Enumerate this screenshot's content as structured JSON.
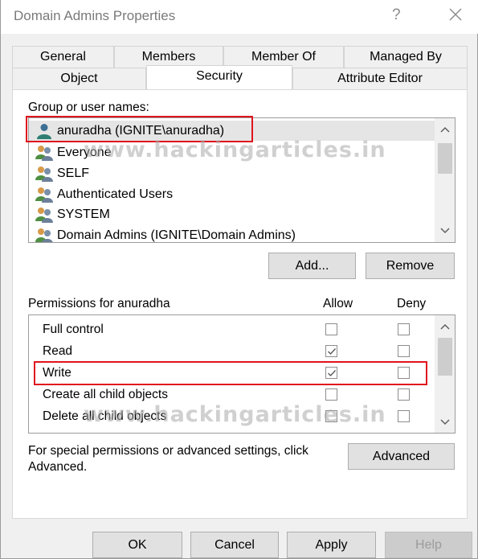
{
  "window": {
    "title": "Domain Admins Properties",
    "help_glyph": "?"
  },
  "tabs": {
    "general": "General",
    "members": "Members",
    "member_of": "Member Of",
    "managed_by": "Managed By",
    "object": "Object",
    "security": "Security",
    "attribute_editor": "Attribute Editor"
  },
  "group_users": {
    "label": "Group or user names:",
    "items": [
      "anuradha (IGNITE\\anuradha)",
      "Everyone",
      "SELF",
      "Authenticated Users",
      "SYSTEM",
      "Domain Admins (IGNITE\\Domain Admins)"
    ],
    "selected_index": 0
  },
  "buttons": {
    "add": "Add...",
    "remove": "Remove",
    "advanced": "Advanced",
    "ok": "OK",
    "cancel": "Cancel",
    "apply": "Apply",
    "help": "Help"
  },
  "permissions": {
    "label": "Permissions for anuradha",
    "allow_header": "Allow",
    "deny_header": "Deny",
    "rows": [
      {
        "name": "Full control",
        "allow": false,
        "deny": false
      },
      {
        "name": "Read",
        "allow": true,
        "deny": false
      },
      {
        "name": "Write",
        "allow": true,
        "deny": false
      },
      {
        "name": "Create all child objects",
        "allow": false,
        "deny": false
      },
      {
        "name": "Delete all child objects",
        "allow": false,
        "deny": false
      }
    ]
  },
  "special": {
    "line1": "For special permissions or advanced settings, click",
    "line2": "Advanced."
  },
  "watermark": "www.hackingarticles.in",
  "colors": {
    "highlight": "#e0141e",
    "selected_row": "#e5e5e5",
    "check": "#5a5a5a"
  }
}
